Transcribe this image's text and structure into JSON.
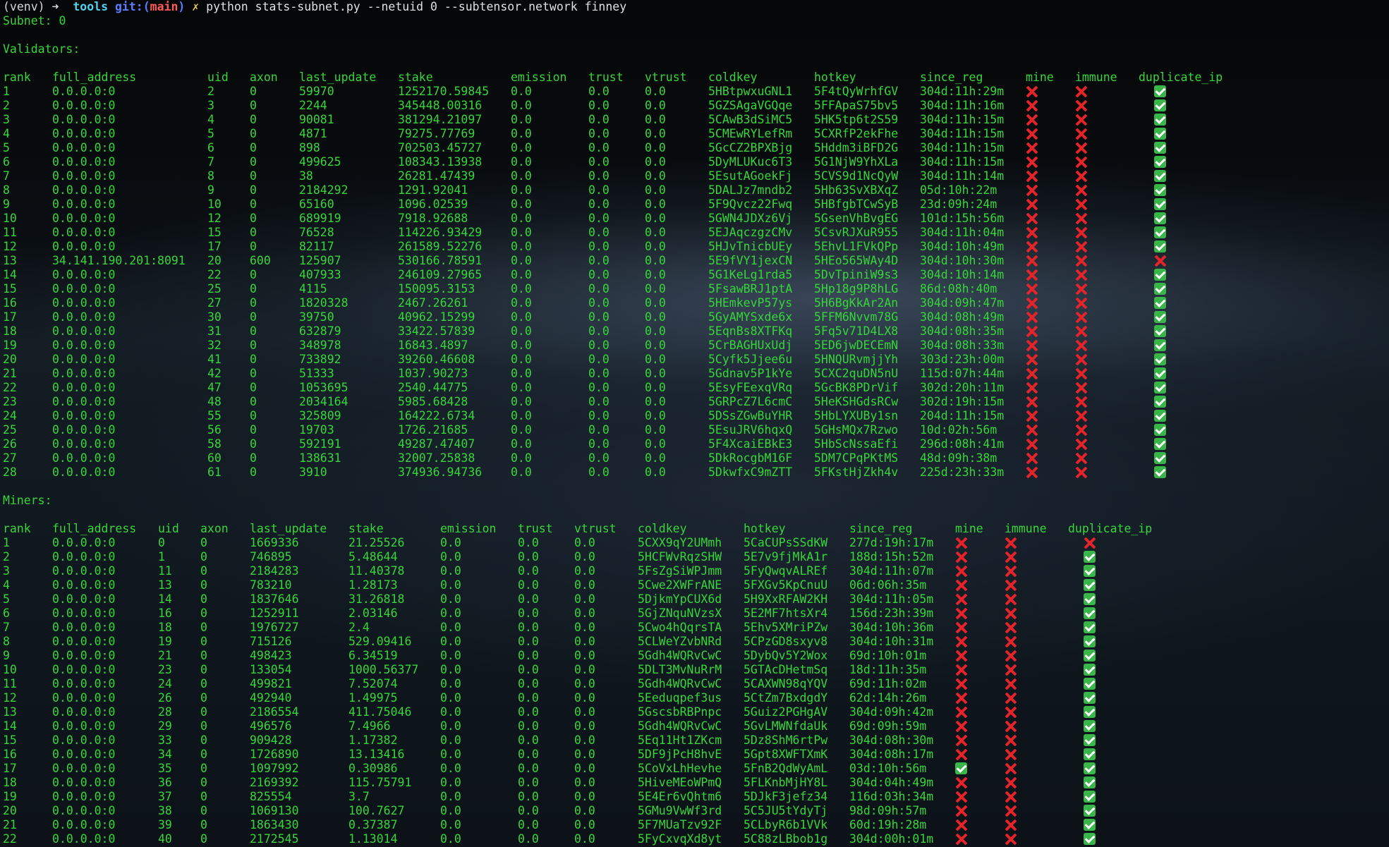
{
  "prompt": {
    "venv": "(venv)",
    "arrow": "➜",
    "dir": "tools",
    "git": "git:(",
    "branch": "main",
    "git_close": ")",
    "dirty": "✗",
    "command": "python stats-subnet.py --netuid 0 --subtensor.network finney"
  },
  "subnet_line": "Subnet: 0",
  "validators": {
    "heading": "Validators:",
    "headers": [
      "rank",
      "full_address",
      "uid",
      "axon",
      "last_update",
      "stake",
      "emission",
      "trust",
      "vtrust",
      "coldkey",
      "hotkey",
      "since_reg",
      "mine",
      "immune",
      "duplicate_ip"
    ],
    "rows": [
      [
        "1",
        "0.0.0.0:0",
        "2",
        "0",
        "59970",
        "1252170.59845",
        "0.0",
        "0.0",
        "0.0",
        "5HBtpwxuGNL1",
        "5F4tQyWrhfGV",
        "304d:11h:29m",
        false,
        false,
        true
      ],
      [
        "2",
        "0.0.0.0:0",
        "3",
        "0",
        "2244",
        "345448.00316",
        "0.0",
        "0.0",
        "0.0",
        "5GZSAgaVGQqe",
        "5FFApaS75bv5",
        "304d:11h:16m",
        false,
        false,
        true
      ],
      [
        "3",
        "0.0.0.0:0",
        "4",
        "0",
        "90081",
        "381294.21097",
        "0.0",
        "0.0",
        "0.0",
        "5CAwB3dSiMC5",
        "5HK5tp6t2S59",
        "304d:11h:15m",
        false,
        false,
        true
      ],
      [
        "4",
        "0.0.0.0:0",
        "5",
        "0",
        "4871",
        "79275.77769",
        "0.0",
        "0.0",
        "0.0",
        "5CMEwRYLefRm",
        "5CXRfP2ekFhe",
        "304d:11h:15m",
        false,
        false,
        true
      ],
      [
        "5",
        "0.0.0.0:0",
        "6",
        "0",
        "898",
        "702503.45727",
        "0.0",
        "0.0",
        "0.0",
        "5GcCZ2BPXBjg",
        "5Hddm3iBFD2G",
        "304d:11h:15m",
        false,
        false,
        true
      ],
      [
        "6",
        "0.0.0.0:0",
        "7",
        "0",
        "499625",
        "108343.13938",
        "0.0",
        "0.0",
        "0.0",
        "5DyMLUKuc6T3",
        "5G1NjW9YhXLa",
        "304d:11h:15m",
        false,
        false,
        true
      ],
      [
        "7",
        "0.0.0.0:0",
        "8",
        "0",
        "38",
        "26281.47439",
        "0.0",
        "0.0",
        "0.0",
        "5EsutAGoekFj",
        "5CVS9d1NcQyW",
        "304d:11h:14m",
        false,
        false,
        true
      ],
      [
        "8",
        "0.0.0.0:0",
        "9",
        "0",
        "2184292",
        "1291.92041",
        "0.0",
        "0.0",
        "0.0",
        "5DALJz7mndb2",
        "5Hb63SvXBXqZ",
        "05d:10h:22m",
        false,
        false,
        true
      ],
      [
        "9",
        "0.0.0.0:0",
        "10",
        "0",
        "65160",
        "1096.02539",
        "0.0",
        "0.0",
        "0.0",
        "5F9Qvcz22Fwq",
        "5HBfgbTCwSyB",
        "23d:09h:24m",
        false,
        false,
        true
      ],
      [
        "10",
        "0.0.0.0:0",
        "12",
        "0",
        "689919",
        "7918.92688",
        "0.0",
        "0.0",
        "0.0",
        "5GWN4JDXz6Vj",
        "5GsenVhBvgEG",
        "101d:15h:56m",
        false,
        false,
        true
      ],
      [
        "11",
        "0.0.0.0:0",
        "15",
        "0",
        "76528",
        "114226.93429",
        "0.0",
        "0.0",
        "0.0",
        "5EJAqczgzCMv",
        "5CsvRJXuR955",
        "304d:11h:04m",
        false,
        false,
        true
      ],
      [
        "12",
        "0.0.0.0:0",
        "17",
        "0",
        "82117",
        "261589.52276",
        "0.0",
        "0.0",
        "0.0",
        "5HJvTnicbUEy",
        "5EhvL1FVkQPp",
        "304d:10h:49m",
        false,
        false,
        true
      ],
      [
        "13",
        "34.141.190.201:8091",
        "20",
        "600",
        "125907",
        "530166.78591",
        "0.0",
        "0.0",
        "0.0",
        "5E9fVY1jexCN",
        "5HEo565WAy4D",
        "304d:10h:30m",
        false,
        false,
        false
      ],
      [
        "14",
        "0.0.0.0:0",
        "22",
        "0",
        "407933",
        "246109.27965",
        "0.0",
        "0.0",
        "0.0",
        "5G1KeLg1rda5",
        "5DvTpiniW9s3",
        "304d:10h:14m",
        false,
        false,
        true
      ],
      [
        "15",
        "0.0.0.0:0",
        "25",
        "0",
        "4115",
        "150095.3153",
        "0.0",
        "0.0",
        "0.0",
        "5FsawBRJ1ptA",
        "5Hp18g9P8hLG",
        "86d:08h:40m",
        false,
        false,
        true
      ],
      [
        "16",
        "0.0.0.0:0",
        "27",
        "0",
        "1820328",
        "2467.26261",
        "0.0",
        "0.0",
        "0.0",
        "5HEmkevP57ys",
        "5H6BgKkAr2An",
        "304d:09h:47m",
        false,
        false,
        true
      ],
      [
        "17",
        "0.0.0.0:0",
        "30",
        "0",
        "39750",
        "40962.15299",
        "0.0",
        "0.0",
        "0.0",
        "5GyAMYSxde6x",
        "5FFM6Nvvm78G",
        "304d:08h:49m",
        false,
        false,
        true
      ],
      [
        "18",
        "0.0.0.0:0",
        "31",
        "0",
        "632879",
        "33422.57839",
        "0.0",
        "0.0",
        "0.0",
        "5EqnBs8XTFKq",
        "5Fq5v71D4LX8",
        "304d:08h:35m",
        false,
        false,
        true
      ],
      [
        "19",
        "0.0.0.0:0",
        "32",
        "0",
        "348978",
        "16843.4897",
        "0.0",
        "0.0",
        "0.0",
        "5CrBAGHUxUdj",
        "5ED6jwDECEmN",
        "304d:08h:33m",
        false,
        false,
        true
      ],
      [
        "20",
        "0.0.0.0:0",
        "41",
        "0",
        "733892",
        "39260.46608",
        "0.0",
        "0.0",
        "0.0",
        "5Cyfk5Jjee6u",
        "5HNQURvmjjYh",
        "303d:23h:00m",
        false,
        false,
        true
      ],
      [
        "21",
        "0.0.0.0:0",
        "42",
        "0",
        "51333",
        "1037.90273",
        "0.0",
        "0.0",
        "0.0",
        "5Gdnav5P1kYe",
        "5CXC2quDN5nU",
        "115d:07h:44m",
        false,
        false,
        true
      ],
      [
        "22",
        "0.0.0.0:0",
        "47",
        "0",
        "1053695",
        "2540.44775",
        "0.0",
        "0.0",
        "0.0",
        "5EsyFEexqVRq",
        "5GcBK8PDrVif",
        "302d:20h:11m",
        false,
        false,
        true
      ],
      [
        "23",
        "0.0.0.0:0",
        "48",
        "0",
        "2034164",
        "5985.68428",
        "0.0",
        "0.0",
        "0.0",
        "5GRPcZ7L6cmC",
        "5HeKSHGdsRCw",
        "302d:19h:15m",
        false,
        false,
        true
      ],
      [
        "24",
        "0.0.0.0:0",
        "55",
        "0",
        "325809",
        "164222.6734",
        "0.0",
        "0.0",
        "0.0",
        "5DSsZGwBuYHR",
        "5HbLYXUBy1sn",
        "204d:11h:15m",
        false,
        false,
        true
      ],
      [
        "25",
        "0.0.0.0:0",
        "56",
        "0",
        "19703",
        "1726.21685",
        "0.0",
        "0.0",
        "0.0",
        "5EsuJRV6hqxQ",
        "5GHsMQx7Rzwo",
        "10d:02h:56m",
        false,
        false,
        true
      ],
      [
        "26",
        "0.0.0.0:0",
        "58",
        "0",
        "592191",
        "49287.47407",
        "0.0",
        "0.0",
        "0.0",
        "5F4XcaiEBkE3",
        "5HbScNssaEfi",
        "296d:08h:41m",
        false,
        false,
        true
      ],
      [
        "27",
        "0.0.0.0:0",
        "60",
        "0",
        "138631",
        "32007.25838",
        "0.0",
        "0.0",
        "0.0",
        "5DkRocgbM16F",
        "5DM7CPqPKtMS",
        "48d:09h:38m",
        false,
        false,
        true
      ],
      [
        "28",
        "0.0.0.0:0",
        "61",
        "0",
        "3910",
        "374936.94736",
        "0.0",
        "0.0",
        "0.0",
        "5DkwfxC9mZTT",
        "5FKstHjZkh4v",
        "225d:23h:33m",
        false,
        false,
        true
      ]
    ]
  },
  "miners": {
    "heading": "Miners:",
    "headers": [
      "rank",
      "full_address",
      "uid",
      "axon",
      "last_update",
      "stake",
      "emission",
      "trust",
      "vtrust",
      "coldkey",
      "hotkey",
      "since_reg",
      "mine",
      "immune",
      "duplicate_ip"
    ],
    "rows": [
      [
        "1",
        "0.0.0.0:0",
        "0",
        "0",
        "1669336",
        "21.25526",
        "0.0",
        "0.0",
        "0.0",
        "5CXX9qY2UMmh",
        "5CaCUPsSSdKW",
        "277d:19h:17m",
        false,
        false,
        false
      ],
      [
        "2",
        "0.0.0.0:0",
        "1",
        "0",
        "746895",
        "5.48644",
        "0.0",
        "0.0",
        "0.0",
        "5HCFWvRqzSHW",
        "5E7v9fjMkA1r",
        "188d:15h:52m",
        false,
        false,
        true
      ],
      [
        "3",
        "0.0.0.0:0",
        "11",
        "0",
        "2184283",
        "11.40378",
        "0.0",
        "0.0",
        "0.0",
        "5FsZgSiWPJmm",
        "5FyQwqvALREf",
        "304d:11h:07m",
        false,
        false,
        true
      ],
      [
        "4",
        "0.0.0.0:0",
        "13",
        "0",
        "783210",
        "1.28173",
        "0.0",
        "0.0",
        "0.0",
        "5Cwe2XWFrANE",
        "5FXGv5KpCnuU",
        "06d:06h:35m",
        false,
        false,
        true
      ],
      [
        "5",
        "0.0.0.0:0",
        "14",
        "0",
        "1837646",
        "31.26818",
        "0.0",
        "0.0",
        "0.0",
        "5DjkmYpCUX6d",
        "5H9XxRFAW2KH",
        "304d:11h:05m",
        false,
        false,
        true
      ],
      [
        "6",
        "0.0.0.0:0",
        "16",
        "0",
        "1252911",
        "2.03146",
        "0.0",
        "0.0",
        "0.0",
        "5GjZNquNVzsX",
        "5E2MF7htsXr4",
        "156d:23h:39m",
        false,
        false,
        true
      ],
      [
        "7",
        "0.0.0.0:0",
        "18",
        "0",
        "1976727",
        "2.4",
        "0.0",
        "0.0",
        "0.0",
        "5Cwo4hQqrsTA",
        "5Ehv5XMriPZw",
        "304d:10h:36m",
        false,
        false,
        true
      ],
      [
        "8",
        "0.0.0.0:0",
        "19",
        "0",
        "715126",
        "529.09416",
        "0.0",
        "0.0",
        "0.0",
        "5CLWeYZvbNRd",
        "5CPzGD8sxyv8",
        "304d:10h:31m",
        false,
        false,
        true
      ],
      [
        "9",
        "0.0.0.0:0",
        "21",
        "0",
        "498423",
        "6.34519",
        "0.0",
        "0.0",
        "0.0",
        "5Gdh4WQRvCwC",
        "5DybQv5Y2Wox",
        "69d:10h:01m",
        false,
        false,
        true
      ],
      [
        "10",
        "0.0.0.0:0",
        "23",
        "0",
        "133054",
        "1000.56377",
        "0.0",
        "0.0",
        "0.0",
        "5DLT3MvNuRrM",
        "5GTAcDHetmSq",
        "18d:11h:35m",
        false,
        false,
        true
      ],
      [
        "11",
        "0.0.0.0:0",
        "24",
        "0",
        "499821",
        "7.52074",
        "0.0",
        "0.0",
        "0.0",
        "5Gdh4WQRvCwC",
        "5CAXWN98qYQV",
        "69d:11h:02m",
        false,
        false,
        true
      ],
      [
        "12",
        "0.0.0.0:0",
        "26",
        "0",
        "492940",
        "1.49975",
        "0.0",
        "0.0",
        "0.0",
        "5Eeduqpef3us",
        "5CtZm7BxdgdY",
        "62d:14h:26m",
        false,
        false,
        true
      ],
      [
        "13",
        "0.0.0.0:0",
        "28",
        "0",
        "2186554",
        "411.75046",
        "0.0",
        "0.0",
        "0.0",
        "5GscsbRBPnpc",
        "5Guiz2PGHgAV",
        "304d:09h:42m",
        false,
        false,
        true
      ],
      [
        "14",
        "0.0.0.0:0",
        "29",
        "0",
        "496576",
        "7.4966",
        "0.0",
        "0.0",
        "0.0",
        "5Gdh4WQRvCwC",
        "5GvLMWNfdaUk",
        "69d:09h:59m",
        false,
        false,
        true
      ],
      [
        "15",
        "0.0.0.0:0",
        "33",
        "0",
        "909428",
        "1.17382",
        "0.0",
        "0.0",
        "0.0",
        "5Eq11Ht1ZKcm",
        "5Dz8ShM6rtPw",
        "304d:08h:30m",
        false,
        false,
        true
      ],
      [
        "16",
        "0.0.0.0:0",
        "34",
        "0",
        "1726890",
        "13.13416",
        "0.0",
        "0.0",
        "0.0",
        "5DF9jPcH8hvE",
        "5Gpt8XWFTXmK",
        "304d:08h:17m",
        false,
        false,
        true
      ],
      [
        "17",
        "0.0.0.0:0",
        "35",
        "0",
        "1097992",
        "0.30986",
        "0.0",
        "0.0",
        "0.0",
        "5CoVxLhHevhe",
        "5FnB2QdWyAmL",
        "03d:10h:56m",
        true,
        false,
        true
      ],
      [
        "18",
        "0.0.0.0:0",
        "36",
        "0",
        "2169392",
        "115.75791",
        "0.0",
        "0.0",
        "0.0",
        "5HiveMEoWPmQ",
        "5FLKnbMjHY8L",
        "304d:04h:49m",
        false,
        false,
        true
      ],
      [
        "19",
        "0.0.0.0:0",
        "37",
        "0",
        "825554",
        "3.7",
        "0.0",
        "0.0",
        "0.0",
        "5E4Er6vQhtm6",
        "5DJkF3jefz34",
        "116d:03h:34m",
        false,
        false,
        true
      ],
      [
        "20",
        "0.0.0.0:0",
        "38",
        "0",
        "1069130",
        "100.7627",
        "0.0",
        "0.0",
        "0.0",
        "5GMu9VwWf3rd",
        "5C5JU5tYdyTj",
        "98d:09h:57m",
        false,
        false,
        true
      ],
      [
        "21",
        "0.0.0.0:0",
        "39",
        "0",
        "1863430",
        "0.37387",
        "0.0",
        "0.0",
        "0.0",
        "5F7MUaTzv92F",
        "5CLbyR6b1VVk",
        "60d:19h:28m",
        false,
        false,
        true
      ],
      [
        "22",
        "0.0.0.0:0",
        "40",
        "0",
        "2172545",
        "1.13014",
        "0.0",
        "0.0",
        "0.0",
        "5FyCxvqXd8yt",
        "5C88zLBbob1g",
        "304d:00h:01m",
        false,
        false,
        true
      ]
    ]
  },
  "colors": {
    "text_green": "#36d63a",
    "x_mark_red": "#e3242b",
    "check_green": "#39b54a",
    "icons": {
      "true": "check-mark-icon",
      "false": "x-mark-icon"
    }
  }
}
